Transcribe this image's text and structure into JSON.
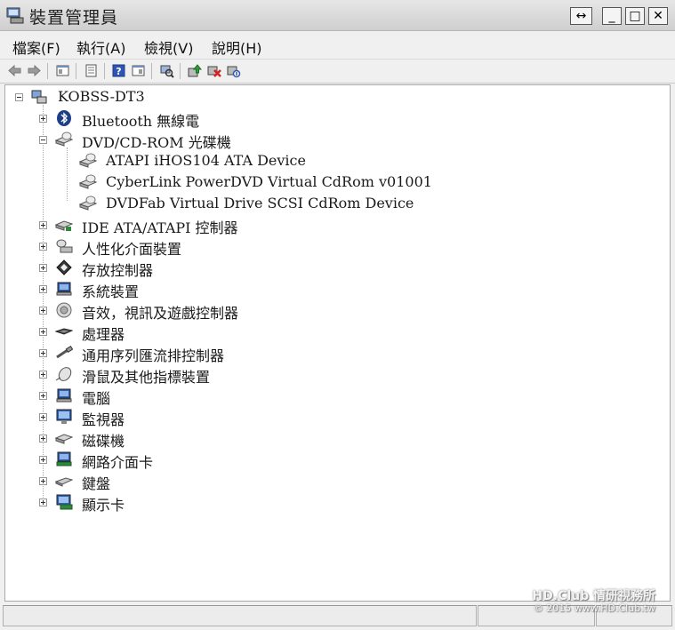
{
  "window": {
    "title": "裝置管理員",
    "buttons": {
      "restore": "↔",
      "minimize": "_",
      "maximize": "□",
      "close": "✕"
    }
  },
  "menu": [
    {
      "label": "檔案(F)"
    },
    {
      "label": "執行(A)"
    },
    {
      "label": "檢視(V)"
    },
    {
      "label": "說明(H)"
    }
  ],
  "toolbar": {
    "icons": [
      "back-arrow-icon",
      "forward-arrow-icon",
      "console-tree-icon",
      "properties-icon",
      "help-icon",
      "action-pane-icon",
      "scan-hardware-icon",
      "update-driver-icon",
      "uninstall-icon",
      "disable-device-icon"
    ]
  },
  "tree": {
    "root": "KOBSS-DT3",
    "categories": [
      {
        "label": "Bluetooth 無線電",
        "icon": "bluetooth-icon",
        "expanded": false
      },
      {
        "label": "DVD/CD-ROM 光碟機",
        "icon": "optical-drive-icon",
        "expanded": true,
        "children": [
          {
            "label": "ATAPI iHOS104 ATA Device"
          },
          {
            "label": "CyberLink PowerDVD Virtual CdRom v01001"
          },
          {
            "label": "DVDFab Virtual Drive SCSI CdRom Device"
          }
        ]
      },
      {
        "label": "IDE ATA/ATAPI 控制器",
        "icon": "ide-controller-icon",
        "expanded": false
      },
      {
        "label": "人性化介面裝置",
        "icon": "hid-icon",
        "expanded": false
      },
      {
        "label": "存放控制器",
        "icon": "storage-controller-icon",
        "expanded": false
      },
      {
        "label": "系統裝置",
        "icon": "system-device-icon",
        "expanded": false
      },
      {
        "label": "音效，視訊及遊戲控制器",
        "icon": "sound-icon",
        "expanded": false
      },
      {
        "label": "處理器",
        "icon": "processor-icon",
        "expanded": false
      },
      {
        "label": "通用序列匯流排控制器",
        "icon": "usb-icon",
        "expanded": false
      },
      {
        "label": "滑鼠及其他指標裝置",
        "icon": "mouse-icon",
        "expanded": false
      },
      {
        "label": "電腦",
        "icon": "computer-icon",
        "expanded": false
      },
      {
        "label": "監視器",
        "icon": "monitor-icon",
        "expanded": false
      },
      {
        "label": "磁碟機",
        "icon": "disk-drive-icon",
        "expanded": false
      },
      {
        "label": "網路介面卡",
        "icon": "network-adapter-icon",
        "expanded": false
      },
      {
        "label": "鍵盤",
        "icon": "keyboard-icon",
        "expanded": false
      },
      {
        "label": "顯示卡",
        "icon": "display-adapter-icon",
        "expanded": false
      }
    ]
  },
  "watermark": {
    "line1": "HD.Club 情研視務所",
    "line2": "© 2015  www.HD.Club.tw"
  }
}
